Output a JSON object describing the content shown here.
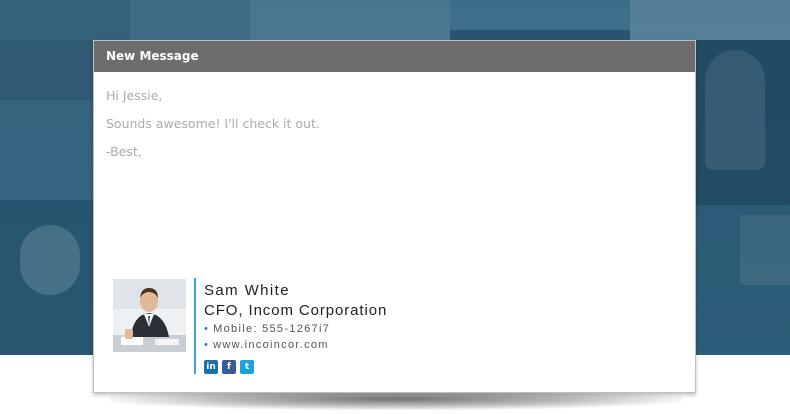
{
  "window": {
    "title": "New Message"
  },
  "message": {
    "lines": [
      "Hi Jessie,",
      "Sounds awesome! I'll check it out.",
      "-Best,"
    ]
  },
  "signature": {
    "name": "Sam White",
    "title": "CFO, Incom Corporation",
    "mobile": "Mobile: 555-1267i7",
    "website": "www.incoincor.com",
    "bullet": "•",
    "social": [
      {
        "icon": "linkedin-icon",
        "glyph": "in",
        "color": "#1c6fa8"
      },
      {
        "icon": "facebook-icon",
        "glyph": "f",
        "color": "#3b5a9a"
      },
      {
        "icon": "twitter-icon",
        "glyph": "t",
        "color": "#1ea0df"
      }
    ]
  },
  "colors": {
    "accent": "#3aa3d4",
    "titlebar": "#6d6d6d",
    "body_text": "#ababab"
  }
}
